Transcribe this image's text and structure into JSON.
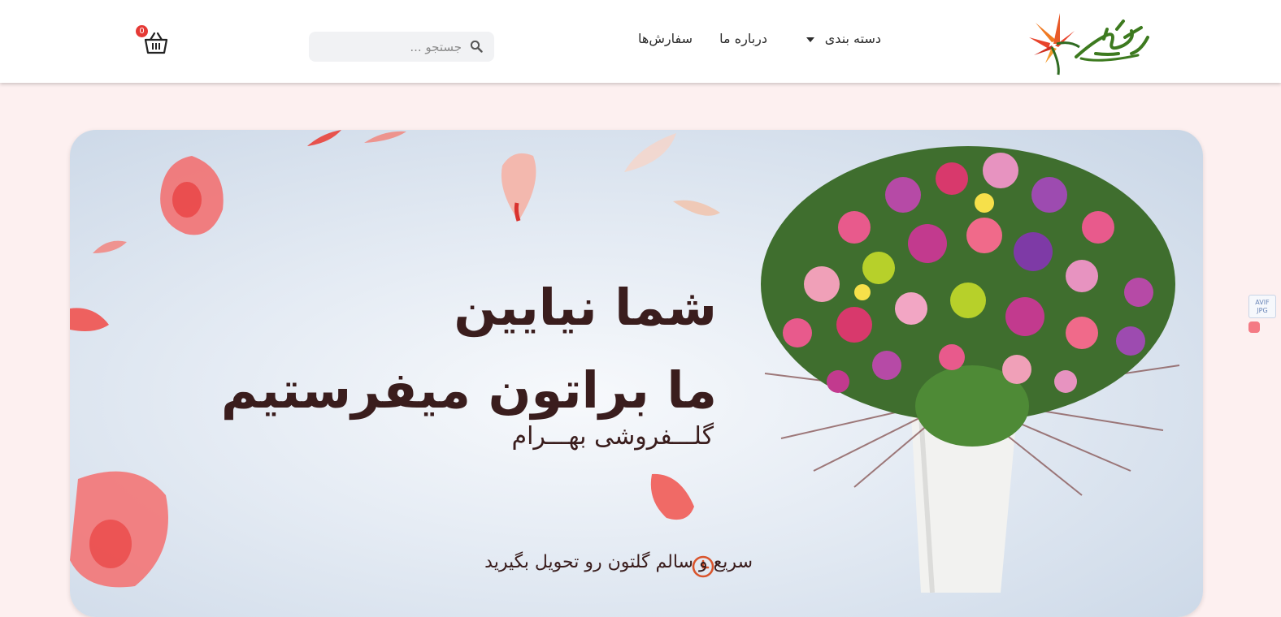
{
  "header": {
    "logo_icon": "bird-of-paradise-logo-icon",
    "nav": {
      "categories_label": "دسته بندی",
      "about_label": "درباره ما",
      "orders_label": "سفارش‌ها"
    },
    "search": {
      "placeholder": "جستجو ...",
      "value": "",
      "icon": "search-icon"
    },
    "cart": {
      "icon": "basket-icon",
      "count": "0"
    }
  },
  "hero": {
    "title_line1": "شما نیایین",
    "title_line2": "ما براتون میفرستیم",
    "subtitle": "گلـــفروشی بهـــرام",
    "feature_icon": "clock-icon",
    "feature_text": "سریع و سالم گلتون رو تحویل بگیرید"
  },
  "side_widget": {
    "line1": "AVIF",
    "line2": "JPG"
  },
  "colors": {
    "page_background": "#fdf0f0",
    "text_dark": "#3a1d1d",
    "accent_red": "#e53935",
    "clock_orange": "#d9542c"
  }
}
